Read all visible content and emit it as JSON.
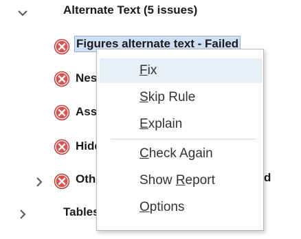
{
  "tree": {
    "alt_text_section": {
      "title": "Alternate Text (5 issues)",
      "expanded": true
    },
    "issues": [
      {
        "label": "Figures alternate text - Failed",
        "status": "failed",
        "selected": true,
        "expandable": false
      },
      {
        "label": "Nest",
        "status": "failed",
        "selected": false,
        "expandable": false
      },
      {
        "label": "Asso",
        "status": "failed",
        "selected": false,
        "expandable": false
      },
      {
        "label": "Hidd",
        "status": "failed",
        "selected": false,
        "expandable": false
      },
      {
        "label": "Othe",
        "status": "failed",
        "selected": false,
        "expandable": true,
        "trailing": "d"
      }
    ],
    "tables_section": {
      "title": "Tables",
      "expanded": false
    }
  },
  "context_menu": {
    "items": [
      {
        "label": "Fix",
        "mnemonic_index": 0,
        "hovered": true
      },
      {
        "label": "Skip Rule",
        "mnemonic_index": 0,
        "hovered": false
      },
      {
        "label": "Explain",
        "mnemonic_index": 0,
        "hovered": false
      },
      {
        "label": "Check Again",
        "mnemonic_index": 0,
        "hovered": false
      },
      {
        "label": "Show Report",
        "mnemonic_index": 5,
        "hovered": false
      },
      {
        "label": "Options",
        "mnemonic_index": 0,
        "hovered": false
      }
    ]
  },
  "colors": {
    "fail_icon_fill": "#d9534f",
    "selection_bg": "#cfe0f4",
    "menu_hover_bg": "#e6eef8"
  },
  "icons": {
    "expanded": "chevron-down-icon",
    "collapsed": "chevron-right-icon",
    "failed": "failed-x-icon"
  }
}
